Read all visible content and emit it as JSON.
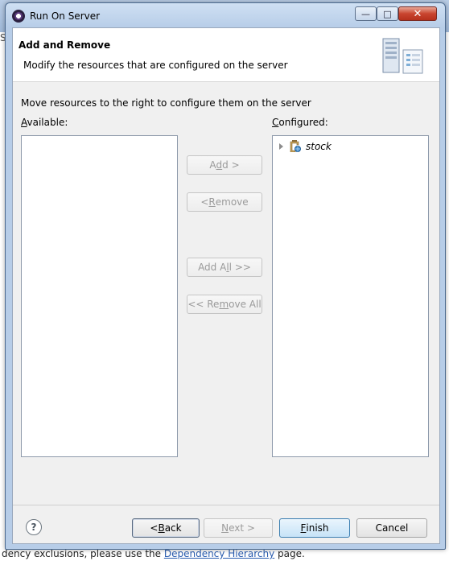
{
  "window": {
    "title": "Run On Server",
    "min_label": "—",
    "max_label": "□",
    "close_label": "✕"
  },
  "header": {
    "title": "Add and Remove",
    "description": "Modify the resources that are configured on the server"
  },
  "instructions": "Move resources to the right to configure them on the server",
  "available": {
    "label_prefix": "",
    "label_mnemonic": "A",
    "label_rest": "vailable:",
    "items": []
  },
  "configured": {
    "label_mnemonic": "C",
    "label_rest": "onfigured:",
    "items": [
      {
        "label": "stock",
        "icon": "web-project-icon"
      }
    ]
  },
  "buttons": {
    "add": {
      "pre": "A",
      "mn": "d",
      "post": "d >"
    },
    "remove": {
      "pre": "< ",
      "mn": "R",
      "post": "emove"
    },
    "add_all": {
      "pre": "Add A",
      "mn": "l",
      "post": "l >>"
    },
    "remove_all": {
      "pre": "<< Re",
      "mn": "m",
      "post": "ove All"
    }
  },
  "footer": {
    "help_label": "?",
    "back": {
      "pre": "< ",
      "mn": "B",
      "post": "ack"
    },
    "next": {
      "pre": "",
      "mn": "N",
      "post": "ext >"
    },
    "finish": {
      "pre": "",
      "mn": "F",
      "post": "inish"
    },
    "cancel": "Cancel"
  },
  "background": {
    "left_char": "S",
    "bottom_text": "dency exclusions, please use the ",
    "bottom_link": "Dependency Hierarchy",
    "bottom_suffix": " page."
  }
}
